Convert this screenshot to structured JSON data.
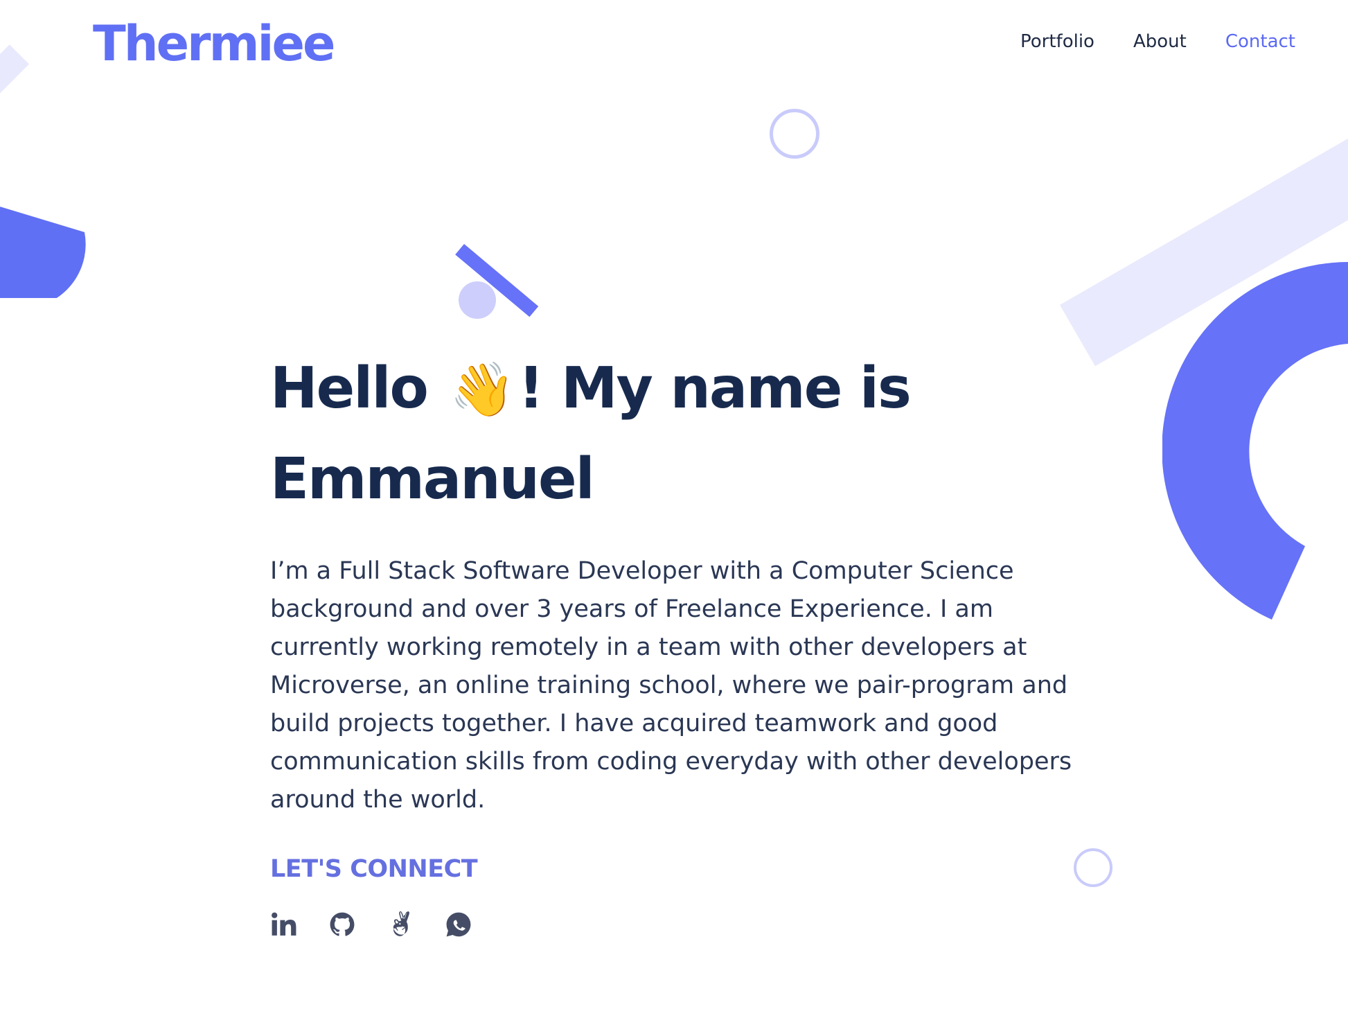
{
  "brand": {
    "logo": "Thermiee",
    "accent_color": "#6070f4",
    "light_accent_color": "#e9eafd",
    "text_color": "#172a4e"
  },
  "nav": {
    "items": [
      {
        "label": "Portfolio",
        "active": false
      },
      {
        "label": "About",
        "active": false
      },
      {
        "label": "Contact",
        "active": true
      }
    ]
  },
  "hero": {
    "title_part1": "Hello",
    "wave_emoji": "👋",
    "title_part2": "! My name is",
    "title_name": "Emmanuel",
    "description": "I’m a Full Stack Software Developer with a Computer Science background and over 3 years of Freelance Experience. I am currently working remotely in a team with other developers at Microverse, an online training school, where we pair-program and build projects together. I have acquired teamwork and good communication skills from coding everyday with other developers around the world.",
    "connect_label": "LET'S CONNECT"
  },
  "socials": [
    {
      "icon": "linkedin-icon"
    },
    {
      "icon": "github-icon"
    },
    {
      "icon": "angellist-icon"
    },
    {
      "icon": "whatsapp-icon"
    }
  ]
}
